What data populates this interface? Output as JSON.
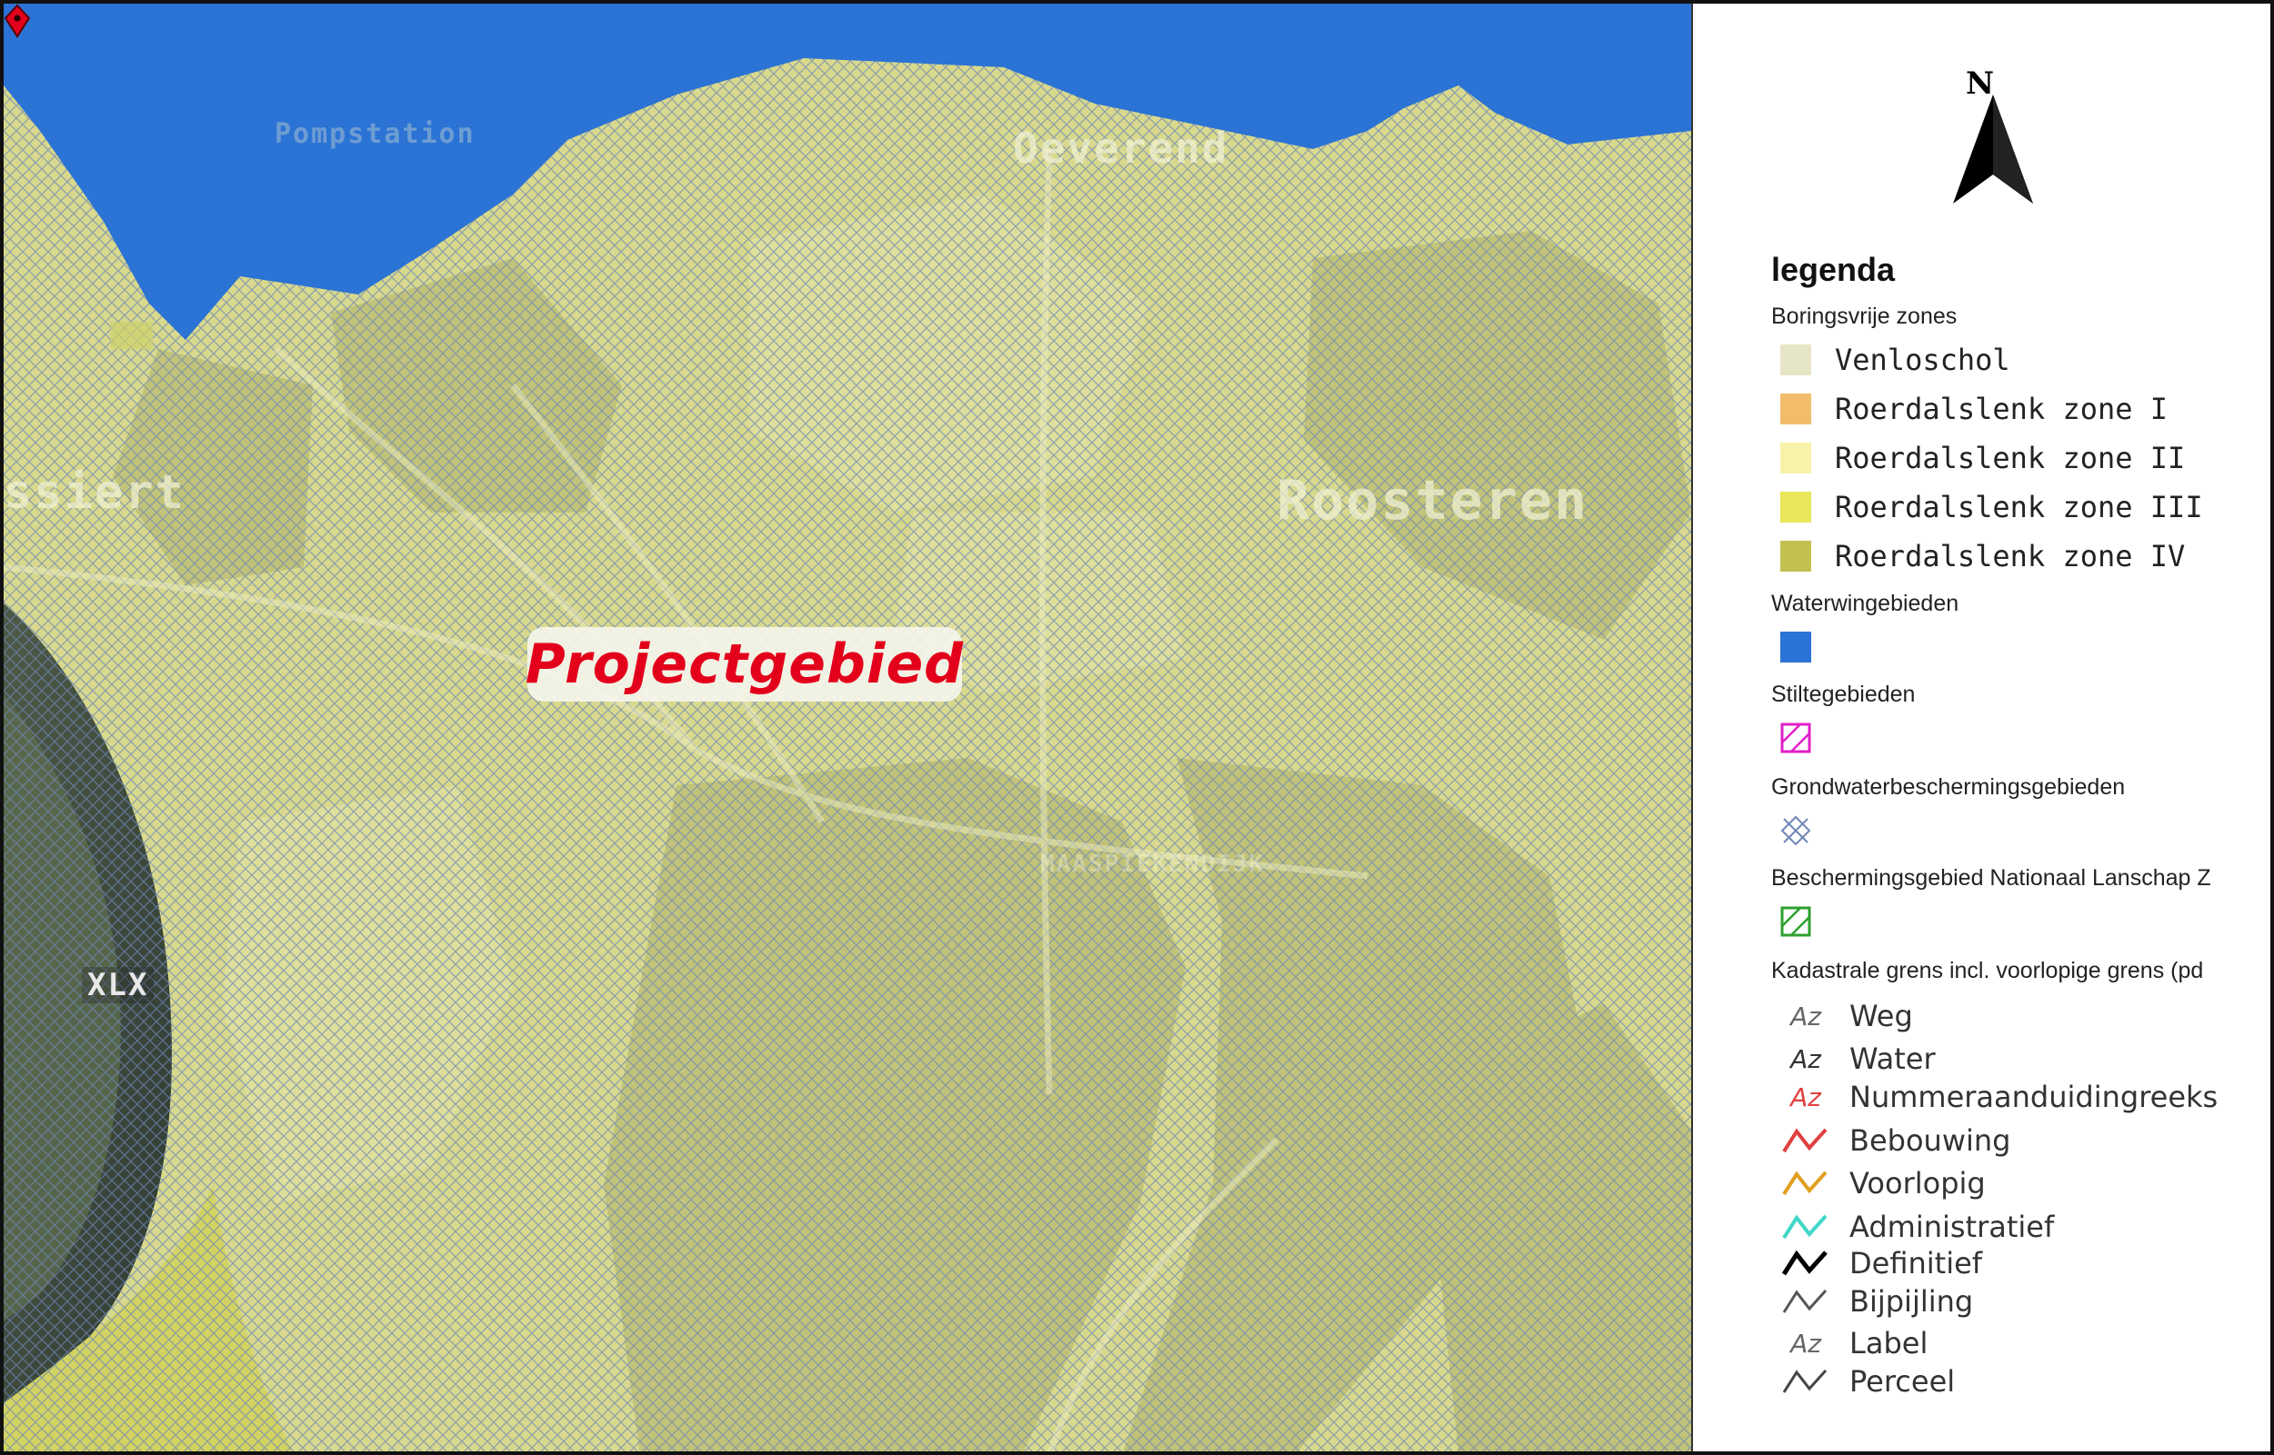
{
  "map": {
    "place_labels": {
      "pompstation": "Pompstation",
      "oeverend": "Oeverend",
      "roosteren": "Roosteren",
      "left_edge": "ssiert",
      "road_number": "XLX",
      "street": "MAASPIEKENDIJK"
    },
    "project_label": "Projectgebied",
    "colors": {
      "water": "#2b73d4",
      "zone_fill": "#d9da86",
      "hatch": "#6f86b8",
      "project": "#e3001b"
    }
  },
  "legend": {
    "north": "N",
    "title": "legenda",
    "groups": {
      "boringsvrij": "Boringsvrije zones",
      "waterwin": "Waterwingebieden",
      "stilte": "Stiltegebieden",
      "grondwater": "Grondwaterbeschermingsgebieden",
      "nationaal": "Beschermingsgebied Nationaal Lanschap Z",
      "kadastraal": "Kadastrale grens incl. voorlopige grens (pd"
    },
    "zones": [
      {
        "label": "Venloschol",
        "color": "#e6e5c8"
      },
      {
        "label": "Roerdalslenk zone I",
        "color": "#f2bd6b"
      },
      {
        "label": "Roerdalslenk zone II",
        "color": "#f6f2a8"
      },
      {
        "label": "Roerdalslenk zone III",
        "color": "#e9e65a"
      },
      {
        "label": "Roerdalslenk zone IV",
        "color": "#c2c14f"
      }
    ],
    "kadastraal_items": [
      {
        "label": "Weg",
        "icon": "az-gray-icon"
      },
      {
        "label": "Water",
        "icon": "az-dark-icon"
      },
      {
        "label": "Nummeraanduidingreeks",
        "icon": "az-red-icon"
      },
      {
        "label": "Bebouwing",
        "icon": "line-red-icon"
      },
      {
        "label": "Voorlopig",
        "icon": "line-orange-icon"
      },
      {
        "label": "Administratief",
        "icon": "line-cyan-icon"
      },
      {
        "label": "Definitief",
        "icon": "line-black-icon"
      },
      {
        "label": "Bijpijling",
        "icon": "line-gray-icon"
      },
      {
        "label": "Label",
        "icon": "az-gray-icon"
      },
      {
        "label": "Perceel",
        "icon": "line-gray-icon"
      }
    ]
  }
}
